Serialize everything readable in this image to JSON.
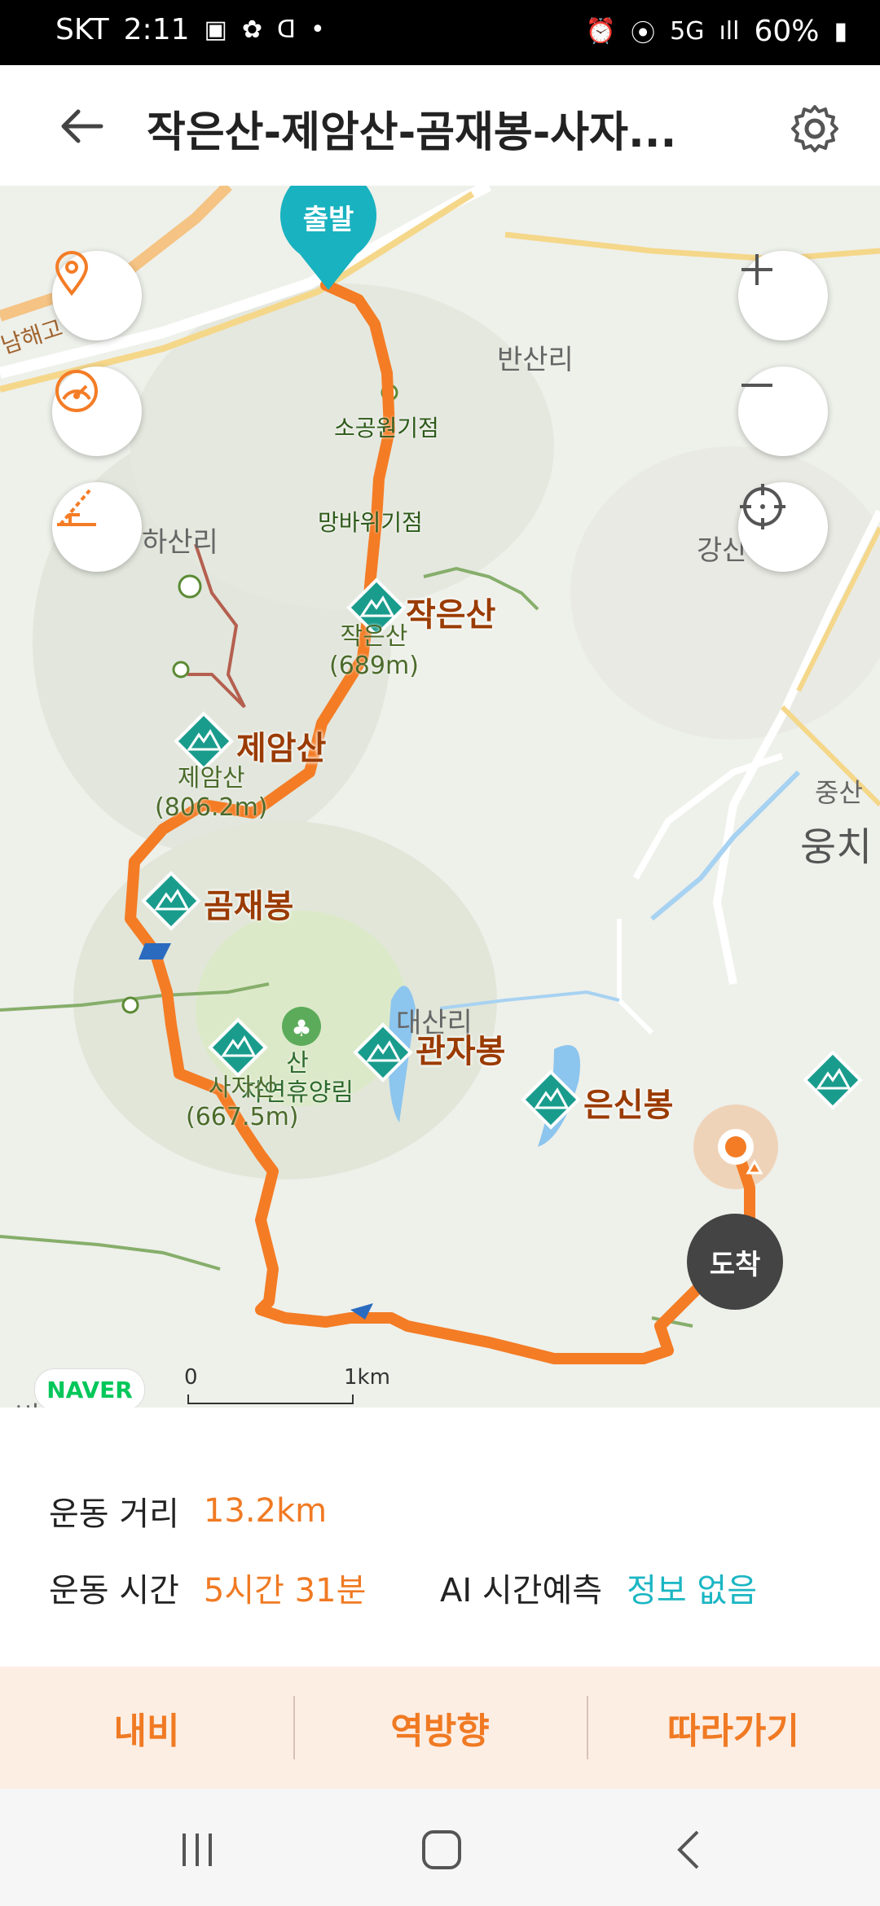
{
  "status": {
    "carrier": "SKT",
    "time": "2:11",
    "battery": "60%"
  },
  "header": {
    "title": "작은산-제암산-곰재봉-사자..."
  },
  "map": {
    "start_label": "출발",
    "end_label": "도착",
    "places": {
      "bansanri": "반산리",
      "hasanri": "하산리",
      "gangsan": "강산",
      "jungsan": "중산",
      "ungchi": "웅치",
      "daesanri": "대산리",
      "bidongri": "비동리",
      "namhae": "남해고",
      "forest": "산\n자연휴양림"
    },
    "waypoints": {
      "sogong": "소공원기점",
      "mangbawi": "망바위기점"
    },
    "peaks": [
      {
        "name": "작은산",
        "sub": "작은산\n(689m)"
      },
      {
        "name": "제암산",
        "sub": "제암산\n(806.2m)"
      },
      {
        "name": "곰재봉",
        "sub": ""
      },
      {
        "name": "",
        "sub": "사자산\n(667.5m)"
      },
      {
        "name": "관자봉",
        "sub": ""
      },
      {
        "name": "은신봉",
        "sub": ""
      }
    ],
    "naver_logo": "NAVER",
    "scale": {
      "start": "0",
      "end": "1km"
    },
    "route_color": "#f47c25",
    "peak_marker_color": "#1a9c8d"
  },
  "info": {
    "distance_label": "운동 거리",
    "distance_value": "13.2km",
    "time_label": "운동 시간",
    "time_value": "5시간 31분",
    "ai_label": "AI 시간예측",
    "ai_value": "정보 없음"
  },
  "actions": {
    "navi": "내비",
    "reverse": "역방향",
    "follow": "따라가기"
  }
}
